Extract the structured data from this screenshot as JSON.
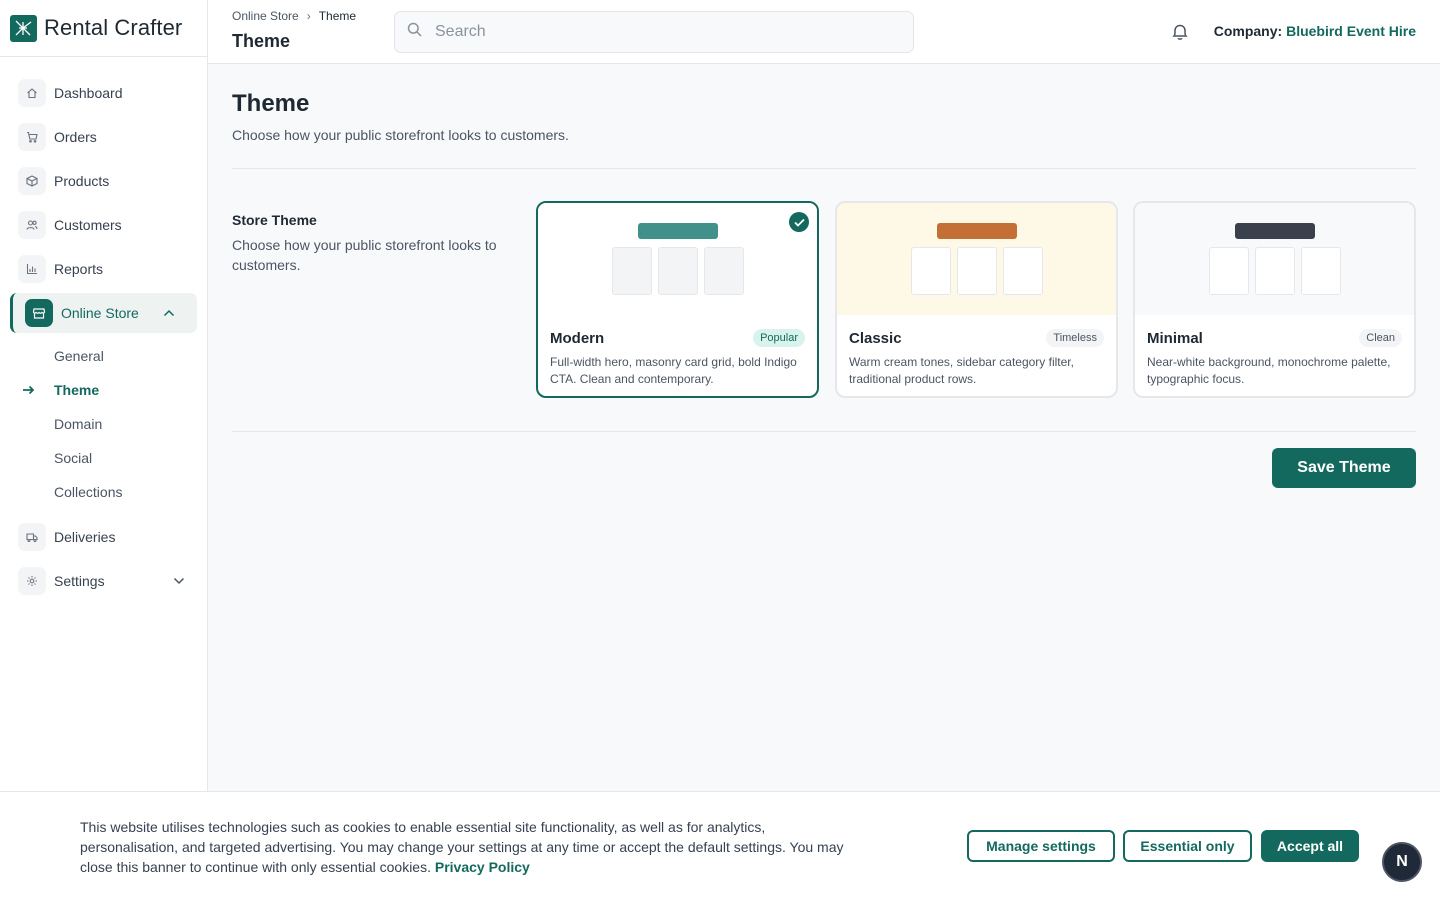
{
  "brand": {
    "name": "Rental Crafter",
    "accent": "#14695f"
  },
  "sidebar": {
    "items": [
      {
        "label": "Dashboard",
        "icon": "home-icon"
      },
      {
        "label": "Orders",
        "icon": "cart-icon"
      },
      {
        "label": "Products",
        "icon": "box-icon"
      },
      {
        "label": "Customers",
        "icon": "users-icon"
      },
      {
        "label": "Reports",
        "icon": "bar-chart-icon"
      },
      {
        "label": "Online Store",
        "icon": "store-icon",
        "expanded": true
      },
      {
        "label": "Deliveries",
        "icon": "truck-icon"
      },
      {
        "label": "Settings",
        "icon": "gear-icon"
      }
    ],
    "sub_items": [
      {
        "label": "General"
      },
      {
        "label": "Theme",
        "active": true
      },
      {
        "label": "Domain"
      },
      {
        "label": "Social"
      },
      {
        "label": "Collections"
      }
    ]
  },
  "header": {
    "breadcrumb": [
      "Online Store",
      "Theme"
    ],
    "title": "Theme",
    "search_placeholder": "Search",
    "company_label": "Company:",
    "company_name": "Bluebird Event Hire"
  },
  "main": {
    "title": "Theme",
    "subtitle": "Choose how your public storefront looks to customers.",
    "section_label": "Store Theme",
    "section_desc": "Choose how your public storefront looks to customers.",
    "themes": [
      {
        "name": "Modern",
        "badge": "Popular",
        "desc": "Full-width hero, masonry card grid, bold Indigo CTA. Clean and contemporary.",
        "selected": true,
        "bar_color": "#3f9189",
        "bg": "#ffffff",
        "box_bg": "#f3f4f6"
      },
      {
        "name": "Classic",
        "badge": "Timeless",
        "desc": "Warm cream tones, sidebar category filter, traditional product rows.",
        "selected": false,
        "bar_color": "#c46f35",
        "bg": "#fdf9e6",
        "box_bg": "#ffffff"
      },
      {
        "name": "Minimal",
        "badge": "Clean",
        "desc": "Near-white background, monochrome palette, typographic focus.",
        "selected": false,
        "bar_color": "#3a414d",
        "bg": "#f8f9fb",
        "box_bg": "#ffffff"
      }
    ],
    "save_label": "Save Theme"
  },
  "cookie": {
    "text": "This website utilises technologies such as cookies to enable essential site functionality, as well as for analytics, personalisation, and targeted advertising. You may change your settings at any time or accept the default settings. You may close this banner to continue with only essential cookies.",
    "link": "Privacy Policy",
    "manage_label": "Manage settings",
    "essential_label": "Essential only",
    "accept_label": "Accept all"
  },
  "assistant_badge": "N"
}
